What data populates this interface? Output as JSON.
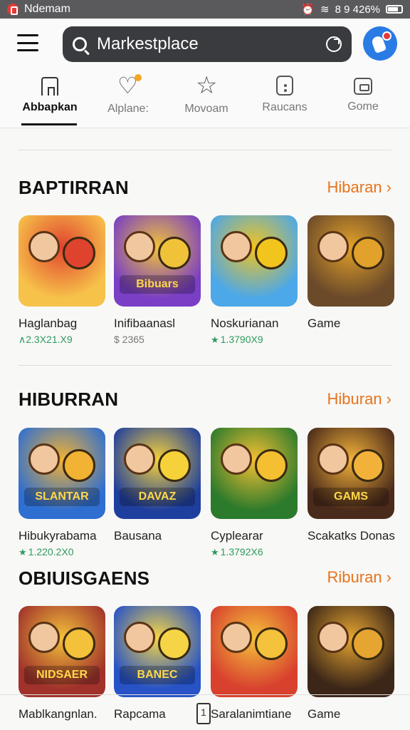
{
  "status_bar": {
    "app_name": "Ndemam",
    "right_text": "8 9 426%"
  },
  "header": {
    "search_value": "Markestplace"
  },
  "tabs": [
    {
      "label": "Abbapkan",
      "icon": "home-icon",
      "active": true
    },
    {
      "label": "Alplane:",
      "icon": "heart-icon",
      "active": false
    },
    {
      "label": "Movoam",
      "icon": "star-icon",
      "active": false
    },
    {
      "label": "Raucans",
      "icon": "bag-icon",
      "active": false
    },
    {
      "label": "Gome",
      "icon": "game-icon",
      "active": false
    }
  ],
  "sections": [
    {
      "title": "BAPTIRRAN",
      "link": "Hibaran ›",
      "apps": [
        {
          "name": "Haglanbag",
          "meta": "∧2.3X21.X9",
          "bg": "#f7c24a",
          "accent": "#e0432d"
        },
        {
          "name": "Inifibaanasl",
          "meta": "$ 2365",
          "bg": "#7a3fc4",
          "accent": "#f0c23a"
        },
        {
          "name": "Noskurianan",
          "meta": "1.3790X9",
          "bg": "#4ca8e8",
          "accent": "#f2c41e"
        },
        {
          "name": "Game",
          "meta": "",
          "bg": "#6b4a2a",
          "accent": "#e2a12a"
        }
      ]
    },
    {
      "title": "HIBURRAN",
      "link": "Hiburan ›",
      "apps": [
        {
          "name": "Hibukyrabama",
          "meta": "1.220.2X0",
          "bg": "#2f6fd1",
          "accent": "#f2b233"
        },
        {
          "name": "Bausana",
          "meta": "",
          "bg": "#1f3f9e",
          "accent": "#f6d23a"
        },
        {
          "name": "Cyplearar",
          "meta": "1.3792X6",
          "bg": "#2c7a2c",
          "accent": "#f4c032"
        },
        {
          "name": "Scakatks Donas",
          "meta": "",
          "bg": "#4a2a1a",
          "accent": "#f2b23a"
        }
      ]
    },
    {
      "title": "OBIUISGAENS",
      "link": "Riburan ›",
      "apps": [
        {
          "name": "Mablkangnlan.",
          "meta": "",
          "bg": "#a0322b",
          "accent": "#f3c13a"
        },
        {
          "name": "Rapcama",
          "meta": "",
          "bg": "#2753c7",
          "accent": "#f5d545"
        },
        {
          "name": "Saralanimtiane",
          "meta": "",
          "bg": "#d8412e",
          "accent": "#f4c23b"
        },
        {
          "name": "Game",
          "meta": "",
          "bg": "#3b2618",
          "accent": "#e6a531"
        }
      ]
    }
  ],
  "tile_text": {
    "s0a1": "Bibuars",
    "s1a0": "SLANTAR",
    "s1a1": "DAVAZ",
    "s1a3": "GAMS",
    "s2a0": "NIDSAER",
    "s2a1": "BANEC"
  }
}
